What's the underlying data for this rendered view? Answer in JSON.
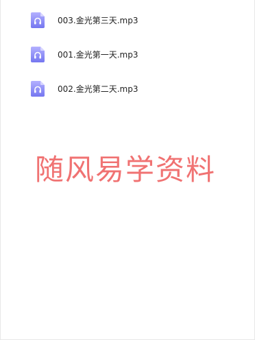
{
  "files": [
    {
      "name": "003.金光第三天.mp3",
      "icon": "audio-file-icon"
    },
    {
      "name": "001.金光第一天.mp3",
      "icon": "audio-file-icon"
    },
    {
      "name": "002.金光第二天.mp3",
      "icon": "audio-file-icon"
    }
  ],
  "watermark": "随风易学资料",
  "colors": {
    "icon_top": "#a9a6ff",
    "icon_bottom": "#7b7cf3",
    "watermark": "#f07272"
  }
}
